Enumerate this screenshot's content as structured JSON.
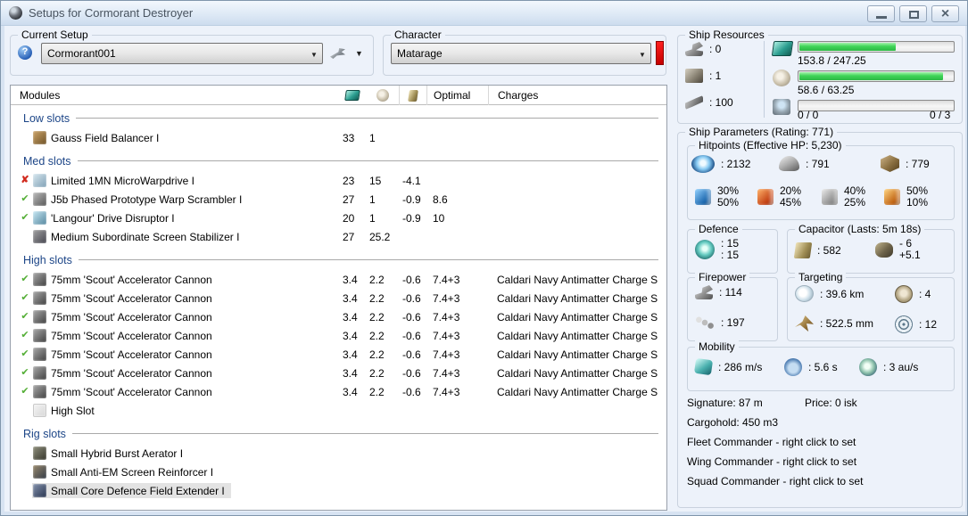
{
  "window": {
    "title": "Setups for Cormorant Destroyer",
    "controls": {
      "minimize": "minimize",
      "maximize": "maximize",
      "close": "close"
    }
  },
  "setup_bar": {
    "current_setup": {
      "label": "Current Setup",
      "value": "Cormorant001"
    },
    "character": {
      "label": "Character",
      "value": "Matarage"
    }
  },
  "modules_table": {
    "columns": {
      "modules": "Modules",
      "optimal": "Optimal",
      "charges": "Charges"
    },
    "sections": [
      {
        "label": "Low slots",
        "rows": [
          {
            "status": "",
            "icon": {
              "name": "gauss-field-balancer-icon",
              "c1": "#cda56a",
              "c2": "#6e5126"
            },
            "name": "Gauss Field Balancer I",
            "cpu": "33",
            "pg": "1",
            "cap": "",
            "optimal": "",
            "charges": ""
          }
        ]
      },
      {
        "label": "Med slots",
        "rows": [
          {
            "status": "error",
            "icon": {
              "name": "microwarpdrive-icon",
              "c1": "#d8e8f0",
              "c2": "#7fa0b5"
            },
            "name": "Limited 1MN MicroWarpdrive I",
            "cpu": "23",
            "pg": "15",
            "cap": "-4.1",
            "optimal": "",
            "charges": ""
          },
          {
            "status": "ok",
            "icon": {
              "name": "warp-scrambler-icon",
              "c1": "#bdbdbd",
              "c2": "#565656"
            },
            "name": "J5b Phased Prototype Warp Scrambler I",
            "cpu": "27",
            "pg": "1",
            "cap": "-0.9",
            "optimal": "8.6",
            "charges": ""
          },
          {
            "status": "ok",
            "icon": {
              "name": "drive-disruptor-icon",
              "c1": "#c8e8f4",
              "c2": "#54869e"
            },
            "name": "'Langour' Drive Disruptor I",
            "cpu": "20",
            "pg": "1",
            "cap": "-0.9",
            "optimal": "10",
            "charges": ""
          },
          {
            "status": "",
            "icon": {
              "name": "screen-stabilizer-icon",
              "c1": "#a3a3a3",
              "c2": "#45454f"
            },
            "name": "Medium Subordinate Screen Stabilizer I",
            "cpu": "27",
            "pg": "25.2",
            "cap": "",
            "optimal": "",
            "charges": ""
          }
        ]
      },
      {
        "label": "High slots",
        "rows": [
          {
            "status": "ok",
            "icon": {
              "name": "hybrid-turret-icon",
              "c1": "#ababab",
              "c2": "#3f3f3f"
            },
            "name": "75mm 'Scout' Accelerator Cannon",
            "cpu": "3.4",
            "pg": "2.2",
            "cap": "-0.6",
            "optimal": "7.4+3",
            "charges": "Caldari Navy Antimatter Charge S"
          },
          {
            "status": "ok",
            "icon": {
              "name": "hybrid-turret-icon",
              "c1": "#ababab",
              "c2": "#3f3f3f"
            },
            "name": "75mm 'Scout' Accelerator Cannon",
            "cpu": "3.4",
            "pg": "2.2",
            "cap": "-0.6",
            "optimal": "7.4+3",
            "charges": "Caldari Navy Antimatter Charge S"
          },
          {
            "status": "ok",
            "icon": {
              "name": "hybrid-turret-icon",
              "c1": "#ababab",
              "c2": "#3f3f3f"
            },
            "name": "75mm 'Scout' Accelerator Cannon",
            "cpu": "3.4",
            "pg": "2.2",
            "cap": "-0.6",
            "optimal": "7.4+3",
            "charges": "Caldari Navy Antimatter Charge S"
          },
          {
            "status": "ok",
            "icon": {
              "name": "hybrid-turret-icon",
              "c1": "#ababab",
              "c2": "#3f3f3f"
            },
            "name": "75mm 'Scout' Accelerator Cannon",
            "cpu": "3.4",
            "pg": "2.2",
            "cap": "-0.6",
            "optimal": "7.4+3",
            "charges": "Caldari Navy Antimatter Charge S"
          },
          {
            "status": "ok",
            "icon": {
              "name": "hybrid-turret-icon",
              "c1": "#ababab",
              "c2": "#3f3f3f"
            },
            "name": "75mm 'Scout' Accelerator Cannon",
            "cpu": "3.4",
            "pg": "2.2",
            "cap": "-0.6",
            "optimal": "7.4+3",
            "charges": "Caldari Navy Antimatter Charge S"
          },
          {
            "status": "ok",
            "icon": {
              "name": "hybrid-turret-icon",
              "c1": "#ababab",
              "c2": "#3f3f3f"
            },
            "name": "75mm 'Scout' Accelerator Cannon",
            "cpu": "3.4",
            "pg": "2.2",
            "cap": "-0.6",
            "optimal": "7.4+3",
            "charges": "Caldari Navy Antimatter Charge S"
          },
          {
            "status": "ok",
            "icon": {
              "name": "hybrid-turret-icon",
              "c1": "#ababab",
              "c2": "#3f3f3f"
            },
            "name": "75mm 'Scout' Accelerator Cannon",
            "cpu": "3.4",
            "pg": "2.2",
            "cap": "-0.6",
            "optimal": "7.4+3",
            "charges": "Caldari Navy Antimatter Charge S"
          },
          {
            "status": "",
            "icon": {
              "name": "empty-high-slot-icon",
              "c1": "#ededed",
              "c2": "#c4c4c4",
              "empty": true
            },
            "name": "High Slot",
            "cpu": "",
            "pg": "",
            "cap": "",
            "optimal": "",
            "charges": ""
          }
        ]
      },
      {
        "label": "Rig slots",
        "rows": [
          {
            "status": "",
            "icon": {
              "name": "hybrid-burst-aerator-icon",
              "c1": "#91917e",
              "c2": "#35352b"
            },
            "name": "Small Hybrid Burst Aerator I",
            "cpu": "",
            "pg": "",
            "cap": "",
            "optimal": "",
            "charges": ""
          },
          {
            "status": "",
            "icon": {
              "name": "anti-em-screen-reinforcer-icon",
              "c1": "#9a8a6e",
              "c2": "#323a46"
            },
            "name": "Small Anti-EM Screen Reinforcer I",
            "cpu": "",
            "pg": "",
            "cap": "",
            "optimal": "",
            "charges": ""
          },
          {
            "status": "",
            "icon": {
              "name": "core-defence-field-extender-icon",
              "c1": "#8593ad",
              "c2": "#27334e"
            },
            "name": "Small Core Defence Field Extender I",
            "cpu": "",
            "pg": "",
            "cap": "",
            "optimal": "",
            "charges": "",
            "selected": true
          }
        ]
      }
    ]
  },
  "ship_resources": {
    "label": "Ship Resources",
    "hardpoints": [
      {
        "icon": "turret-hardpoints-icon",
        "value": ": 0"
      },
      {
        "icon": "launcher-hardpoints-icon",
        "value": ": 1"
      },
      {
        "icon": "calibration-icon",
        "value": ": 100"
      }
    ],
    "bars": [
      {
        "icon": "cpu-icon",
        "text": "153.8 / 247.25",
        "percent": 62.2
      },
      {
        "icon": "powergrid-icon",
        "text": "58.6 / 63.25",
        "percent": 92.6
      },
      {
        "icon": "drones-icon",
        "text_left": "0 / 0",
        "text_right": "0 / 3",
        "percent": 0
      }
    ]
  },
  "ship_parameters": {
    "label": "Ship Parameters (Rating: 771)",
    "hitpoints": {
      "label": "Hitpoints (Effective HP: 5,230)",
      "shield": ": 2132",
      "armor": ": 791",
      "structure": ": 779",
      "resists": [
        {
          "name": "em",
          "top": "30%",
          "bottom": "50%"
        },
        {
          "name": "thermal",
          "top": "20%",
          "bottom": "45%"
        },
        {
          "name": "kinetic",
          "top": "40%",
          "bottom": "25%"
        },
        {
          "name": "explosive",
          "top": "50%",
          "bottom": "10%"
        }
      ]
    },
    "defence": {
      "label": "Defence",
      "top": ": 15",
      "bottom": ": 15"
    },
    "capacitor": {
      "label": "Capacitor (Lasts: 5m 18s)",
      "amount": ": 582",
      "delta_top": "- 6",
      "delta_bottom": "+5.1"
    },
    "firepower": {
      "label": "Firepower",
      "volley": ": 114",
      "dps": ": 197"
    },
    "targeting": {
      "label": "Targeting",
      "range": ": 39.6 km",
      "max_targets": ": 4",
      "scan_res": ": 522.5 mm",
      "sensor_strength": ": 12"
    },
    "mobility": {
      "label": "Mobility",
      "speed": ": 286 m/s",
      "align_time": ": 5.6 s",
      "warp_speed": ": 3 au/s"
    },
    "footer": {
      "signature": "Signature: 87 m",
      "price": "Price: 0 isk",
      "cargohold": "Cargohold: 450 m3",
      "fleet": "Fleet Commander - right click to set",
      "wing": "Wing Commander - right click to set",
      "squad": "Squad Commander - right click to set"
    }
  }
}
